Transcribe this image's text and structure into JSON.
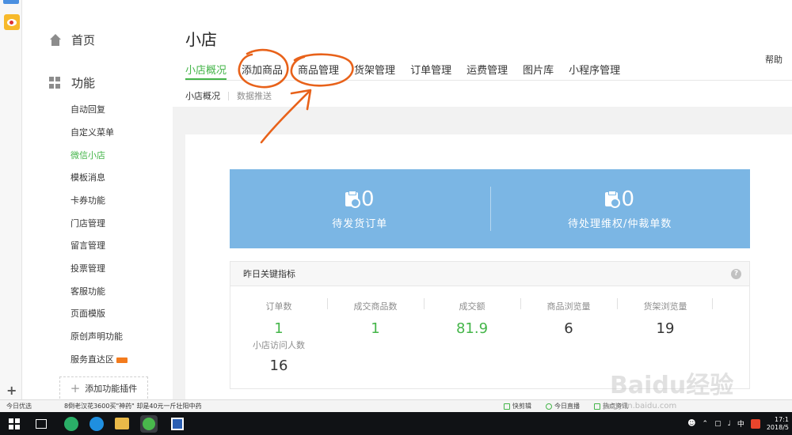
{
  "sidebar": {
    "home_label": "首页",
    "function_label": "功能",
    "items": [
      {
        "label": "自动回复",
        "active": false
      },
      {
        "label": "自定义菜单",
        "active": false
      },
      {
        "label": "微信小店",
        "active": true
      },
      {
        "label": "模板消息",
        "active": false
      },
      {
        "label": "卡券功能",
        "active": false
      },
      {
        "label": "门店管理",
        "active": false
      },
      {
        "label": "留言管理",
        "active": false
      },
      {
        "label": "投票管理",
        "active": false
      },
      {
        "label": "客服功能",
        "active": false
      },
      {
        "label": "页面模版",
        "active": false
      },
      {
        "label": "原创声明功能",
        "active": false
      },
      {
        "label": "服务直达区",
        "active": false
      }
    ],
    "add_plugin_label": "添加功能插件"
  },
  "main": {
    "title": "小店",
    "help_label": "帮助",
    "tabs": [
      {
        "label": "小店概况",
        "active": true
      },
      {
        "label": "添加商品",
        "active": false
      },
      {
        "label": "商品管理",
        "active": false
      },
      {
        "label": "货架管理",
        "active": false
      },
      {
        "label": "订单管理",
        "active": false
      },
      {
        "label": "运费管理",
        "active": false
      },
      {
        "label": "图片库",
        "active": false
      },
      {
        "label": "小程序管理",
        "active": false
      }
    ],
    "subtabs": [
      {
        "label": "小店概况"
      },
      {
        "label": "数据推送"
      }
    ],
    "banner": [
      {
        "value": "0",
        "label": "待发货订单"
      },
      {
        "value": "0",
        "label": "待处理维权/仲裁单数"
      }
    ],
    "metrics": {
      "title": "昨日关键指标",
      "help_icon": "?",
      "items": [
        {
          "label": "订单数",
          "value": "1"
        },
        {
          "label": "成交商品数",
          "value": "1"
        },
        {
          "label": "成交额",
          "value": "81.9"
        },
        {
          "label": "商品浏览量",
          "value": "6"
        },
        {
          "label": "货架浏览量",
          "value": "19"
        },
        {
          "label": "小店访问人数",
          "value": "16"
        }
      ]
    }
  },
  "statusbar": {
    "left_label": "今日优选",
    "news": "8倒老汉花3600买\"神药\" 却是40元一斤壮阳中药",
    "items": [
      "快剪辑",
      "今日直播",
      "热点资讯"
    ]
  },
  "watermark": {
    "text": "Baidu经验",
    "sub": "jingyan.baidu.com"
  },
  "taskbar": {
    "tray_ime": "中",
    "time": "17:1",
    "date": "2018/5"
  },
  "colors": {
    "accent_green": "#44b549",
    "banner_blue": "#7bb6e4",
    "annotation_orange": "#e8621a"
  }
}
